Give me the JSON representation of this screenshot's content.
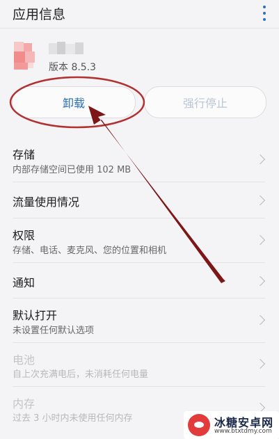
{
  "header": {
    "title": "应用信息",
    "menu_icon": "more-vertical-icon"
  },
  "app": {
    "version": "版本 8.5.3"
  },
  "buttons": {
    "uninstall": "卸载",
    "force_stop": "强行停止"
  },
  "rows": [
    {
      "title": "存储",
      "sub": "内部存储空间已使用 102 MB"
    },
    {
      "title": "流量使用情况"
    },
    {
      "title": "权限",
      "sub": "存储、电话、麦克风、您的位置和相机"
    },
    {
      "title": "通知"
    },
    {
      "title": "默认打开",
      "sub": "未设置任何默认选项"
    },
    {
      "title": "电池",
      "sub": "自上次充满电后，未消耗任何电量"
    },
    {
      "title": "内存",
      "sub": "过去 3 小时内未使用任何内存"
    }
  ],
  "watermark": {
    "name": "冰糖安卓网",
    "url": "www.btxtdmy.com"
  },
  "colors": {
    "accent": "#2a6fb8",
    "annotation": "#8b1c1c",
    "background": "#f4f4f6"
  }
}
